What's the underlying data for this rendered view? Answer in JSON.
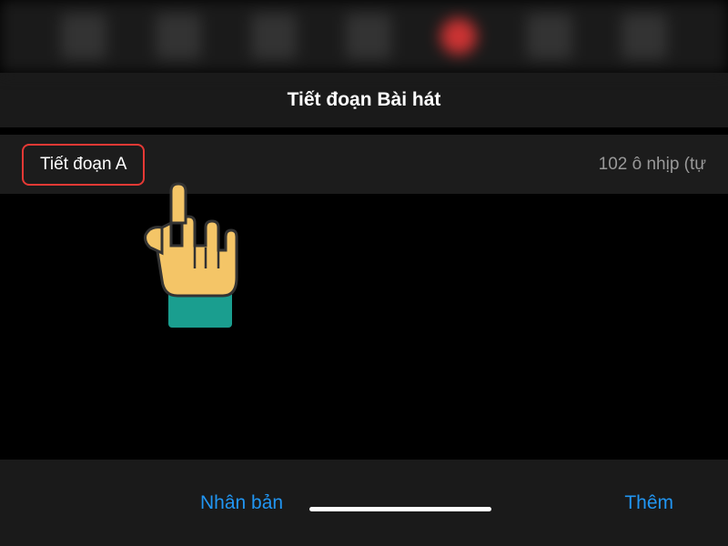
{
  "header": {
    "title": "Tiết đoạn Bài hát"
  },
  "section": {
    "label": "Tiết đoạn A",
    "info": "102 ô nhịp (tự"
  },
  "bottom": {
    "duplicate": "Nhân bản",
    "add": "Thêm"
  }
}
